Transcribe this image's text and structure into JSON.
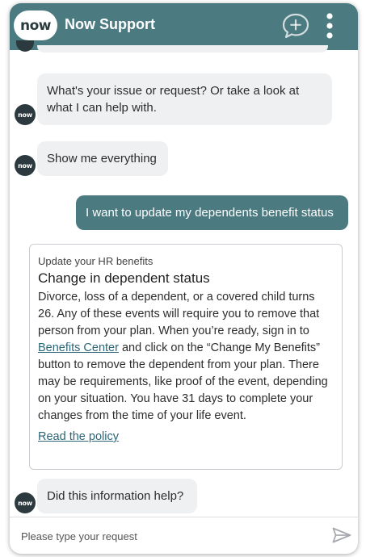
{
  "header": {
    "logo_text": "now",
    "title": "Now Support",
    "background": "#4b7a80"
  },
  "avatar": {
    "text": "now",
    "color": "#2c3a3f"
  },
  "messages": [
    {
      "sender": "bot",
      "text": "What's your issue or request? Or take a look at what I can help with."
    },
    {
      "sender": "bot",
      "text": "Show me everything"
    },
    {
      "sender": "user",
      "text": "I want to update my dependents benefit status"
    },
    {
      "sender": "bot",
      "text": "Did this information help?"
    }
  ],
  "card": {
    "eyebrow": "Update your HR benefits",
    "title": "Change in dependent status",
    "body_part1": "Divorce, loss of a dependent, or a covered child turns 26. Any of these events will require you to remove that person from your plan. When you’re ready, sign in to ",
    "body_link": "Benefits Center",
    "body_part2": " and click on the “Change My Benefits” button to remove the dependent from your plan. There may be requirements, like proof of the event, depending on your situation. You have 31 days to complete your changes from the time of your life event.",
    "footer_link": "Read the policy"
  },
  "input": {
    "placeholder": "Please type your request",
    "value": ""
  },
  "icons": {
    "new_chat": "chat-plus-icon",
    "menu": "vertical-dots-icon",
    "send": "send-icon"
  }
}
